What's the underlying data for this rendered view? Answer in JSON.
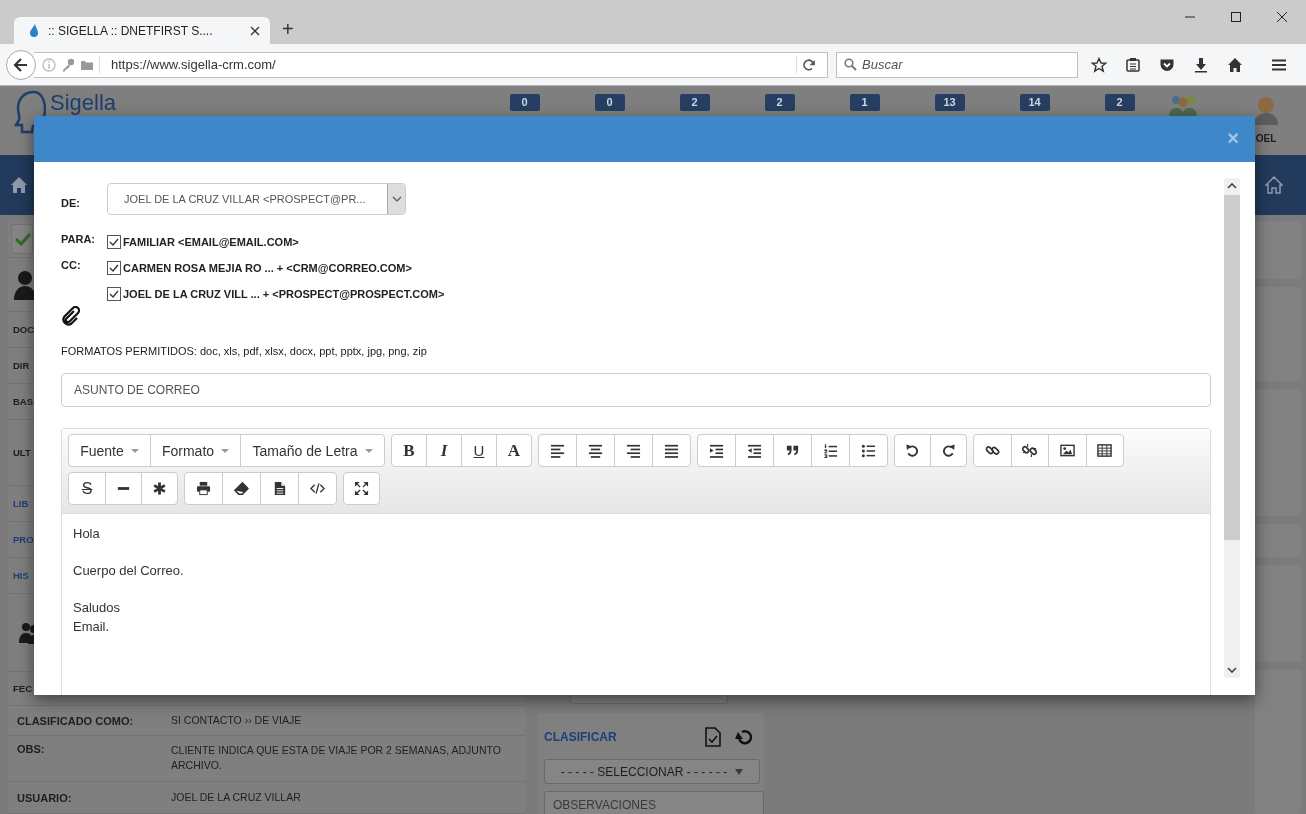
{
  "browser": {
    "tab_title": ":: SIGELLA :: DNETFIRST S....",
    "new_tab_label": "+",
    "url": "https://www.sigella-crm.com/",
    "search_placeholder": "Buscar"
  },
  "app_header": {
    "logo": "Sigella",
    "badges": [
      "0",
      "0",
      "2",
      "2",
      "1",
      "13",
      "14",
      "2"
    ],
    "user_name": "OEL"
  },
  "left_panel": {
    "cut_labels": [
      "DOC",
      "DIR",
      "BAS",
      "ULT"
    ],
    "section_links": [
      "LIB",
      "PRO",
      "HIS"
    ],
    "bottom_cut_label": "FEC",
    "rows": [
      {
        "label": "CLASIFICADO COMO:",
        "value": "SI CONTACTO ›› DE VIAJE"
      },
      {
        "label": "OBS:",
        "value": "CLIENTE INDICA QUE ESTA DE VIAJE POR 2 SEMANAS, ADJUNTO ARCHIVO."
      },
      {
        "label": "USUARIO:",
        "value": "JOEL DE LA CRUZ VILLAR"
      }
    ]
  },
  "right_panel": {
    "title": "CLASIFICAR",
    "select_value": "- - - - - SELECCIONAR - - - - - -",
    "observations_placeholder": "OBSERVACIONES"
  },
  "modal": {
    "close_label": "×",
    "from_label": "DE:",
    "from_value": "JOEL DE LA CRUZ VILLAR <PROSPECT@PR...",
    "to_label": "PARA:",
    "cc_label": "CC:",
    "to": [
      {
        "label": "FAMILIAR <EMAIL@EMAIL.COM>",
        "checked": true
      }
    ],
    "cc": [
      {
        "label": "CARMEN ROSA MEJIA RO ... + <CRM@CORREO.COM>",
        "checked": true
      },
      {
        "label": "JOEL DE LA CRUZ VILL ... + <PROSPECT@PROSPECT.COM>",
        "checked": true
      }
    ],
    "formats_note": "FORMATOS PERMITIDOS: doc, xls, pdf, xlsx, docx, ppt, pptx, jpg, png, zip",
    "subject_placeholder": "ASUNTO DE CORREO",
    "toolbar": {
      "dropdowns": [
        "Fuente",
        "Formato",
        "Tamaño de Letra"
      ],
      "letters": [
        "B",
        "I",
        "U",
        "A"
      ],
      "strike": "S"
    },
    "body": [
      [
        "Hola"
      ],
      [
        "Cuerpo del Correo."
      ],
      [
        "Saludos",
        "Email."
      ]
    ]
  }
}
